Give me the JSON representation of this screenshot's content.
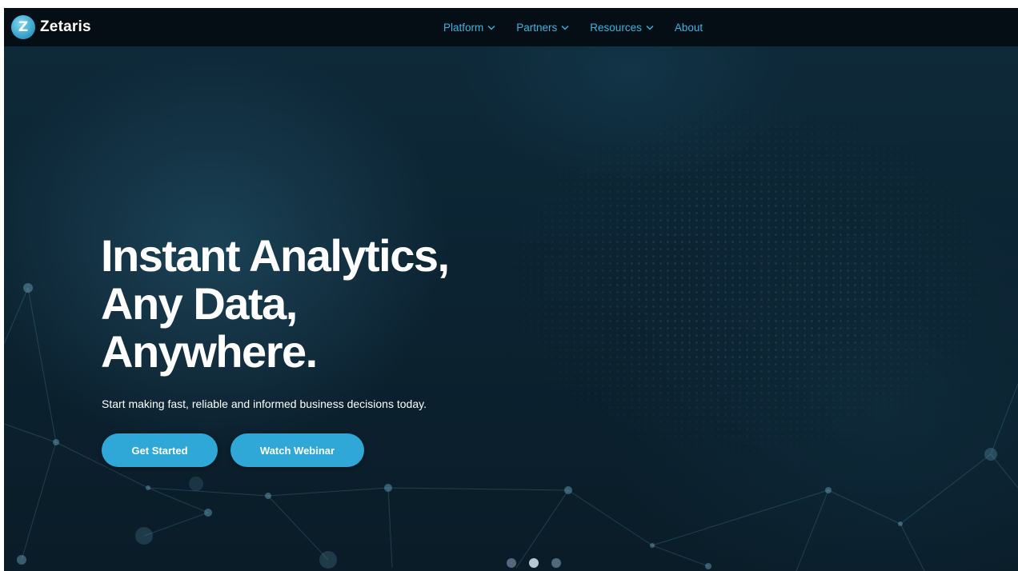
{
  "brand": {
    "name": "Zetaris",
    "logo_glyph": "Z",
    "accent_color": "#3bb4e2",
    "button_color": "#2fa8d8"
  },
  "nav": {
    "items": [
      {
        "label": "Platform",
        "icon": "chevron-down-icon"
      },
      {
        "label": "Partners",
        "icon": "chevron-down-icon"
      },
      {
        "label": "Resources",
        "icon": "chevron-down-icon"
      },
      {
        "label": "About"
      }
    ]
  },
  "hero": {
    "headline": [
      "Instant Analytics,",
      "Any Data,",
      "Anywhere."
    ],
    "subtitle": "Start making fast, reliable and informed business decisions today.",
    "primary_button": "Get Started",
    "secondary_button": "Watch Webinar"
  },
  "carousel": {
    "slide_count": 3,
    "active_slide": 2
  }
}
